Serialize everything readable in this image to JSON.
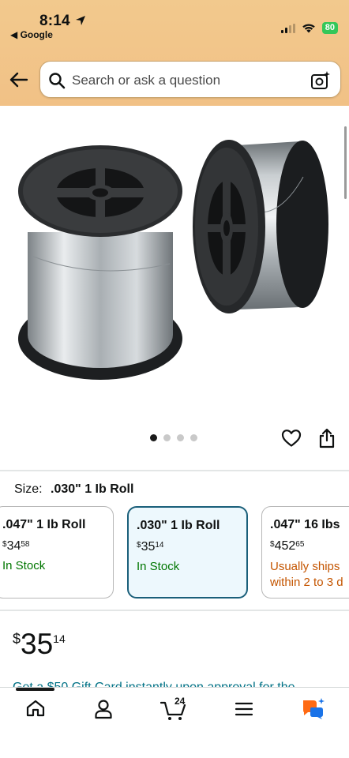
{
  "status_bar": {
    "time": "8:14",
    "back_app": "◀ Google",
    "battery": "80"
  },
  "search": {
    "placeholder": "Search or ask a question"
  },
  "product": {
    "image_dots": 4,
    "active_dot": 0
  },
  "size": {
    "label": "Size:",
    "selected": ".030\" 1 Ib Roll",
    "options": [
      {
        "title": ".047\" 1 Ib Roll",
        "currency": "$",
        "whole": "34",
        "cents": "58",
        "stock": "In Stock",
        "stock_color": "#007600",
        "selected": false
      },
      {
        "title": ".030\" 1 Ib Roll",
        "currency": "$",
        "whole": "35",
        "cents": "14",
        "stock": "In Stock",
        "stock_color": "#007600",
        "selected": true
      },
      {
        "title": ".047\" 16 Ibs",
        "currency": "$",
        "whole": "452",
        "cents": "65",
        "stock": "Usually ships within 2 to 3 d",
        "stock_color": "#c45500",
        "selected": false
      }
    ]
  },
  "price": {
    "currency": "$",
    "whole": "35",
    "cents": "14"
  },
  "promo_text": "Get a $50 Gift Card instantly upon approval for the",
  "nav": {
    "cart_count": "24",
    "home_label": "home-icon",
    "colors": {
      "accent": "#1a5f7a",
      "stock_green": "#007600",
      "ships_orange": "#c45500",
      "link": "#007185"
    }
  }
}
